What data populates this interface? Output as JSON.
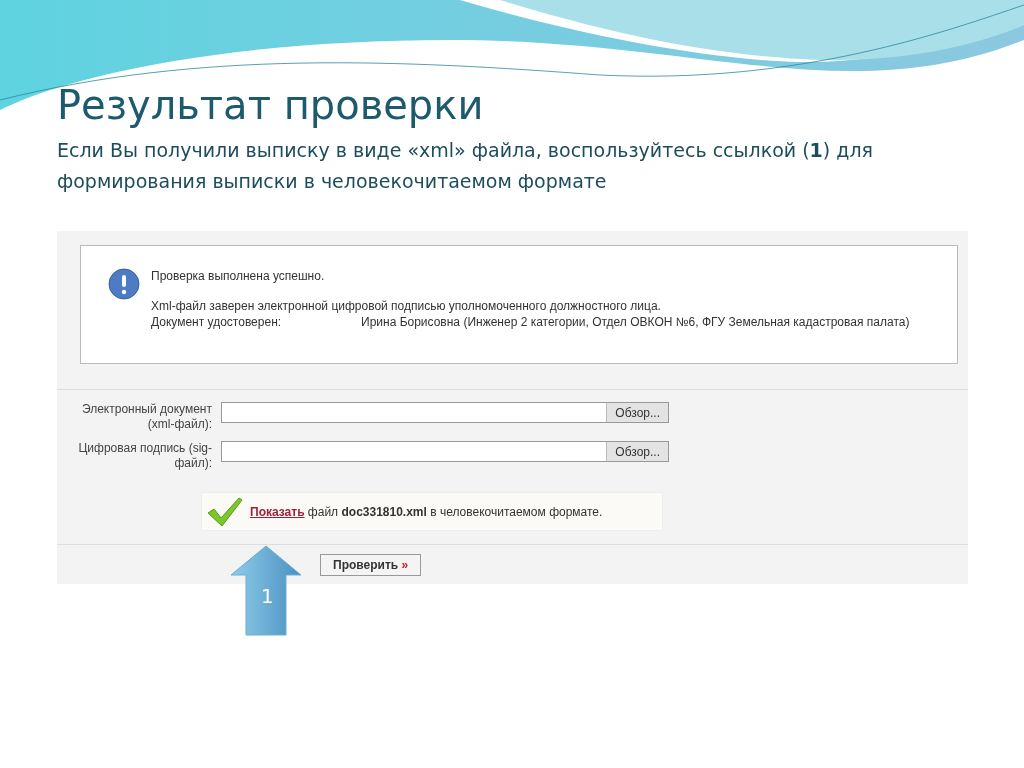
{
  "title": "Результат проверки",
  "subtitle": "Если Вы получили выписку в виде «xml» файла, воспользуйтесь ссылкой (**1**) для формирования выписки в человекочитаемом формате",
  "message": {
    "status": "Проверка выполнена успешно.",
    "signed": "Xml-файл заверен электронной цифровой подписью уполномоченного должностного лица.",
    "certified_label": "Документ удостоверен:",
    "certified_value": "Ирина Борисовна (Инженер 2 категории, Отдел ОВКОН №6, ФГУ Земельная кадастровая палата)"
  },
  "fields": [
    {
      "label": "Электронный документ (xml-файл):",
      "button": "Обзор..."
    },
    {
      "label": "Цифровая подпись (sig-файл):",
      "button": "Обзор..."
    }
  ],
  "result": {
    "link": "Показать",
    "word": "файл",
    "filename": "doc331810.xml",
    "tail": "в человекочитаемом формате."
  },
  "submit": {
    "label": "Проверить",
    "mark": "»"
  },
  "callout": {
    "number": "1"
  }
}
